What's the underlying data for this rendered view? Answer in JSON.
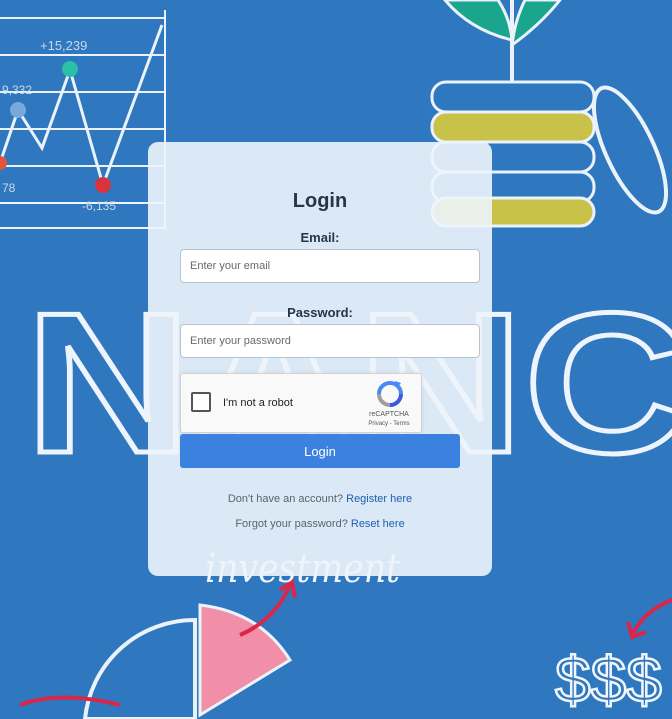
{
  "background": {
    "chart_labels": [
      "+15,239",
      "9,332",
      "78",
      "-6,135"
    ],
    "big_word": "NANC",
    "script_word": "investment",
    "dollar_signs": "$$$"
  },
  "login": {
    "title": "Login",
    "email_label": "Email:",
    "email_placeholder": "Enter your email",
    "password_label": "Password:",
    "password_placeholder": "Enter your password",
    "button_label": "Login",
    "register_prompt": "Don't have an account?",
    "register_link": "Register here",
    "forgot_prompt": "Forgot your password?",
    "reset_link": "Reset here"
  },
  "captcha": {
    "label": "I'm not a robot",
    "brand": "reCAPTCHA",
    "links": "Privacy - Terms"
  },
  "colors": {
    "background": "#2f78bf",
    "button": "#3b82e0",
    "link": "#1e5fb3",
    "title_text": "#26354a"
  }
}
